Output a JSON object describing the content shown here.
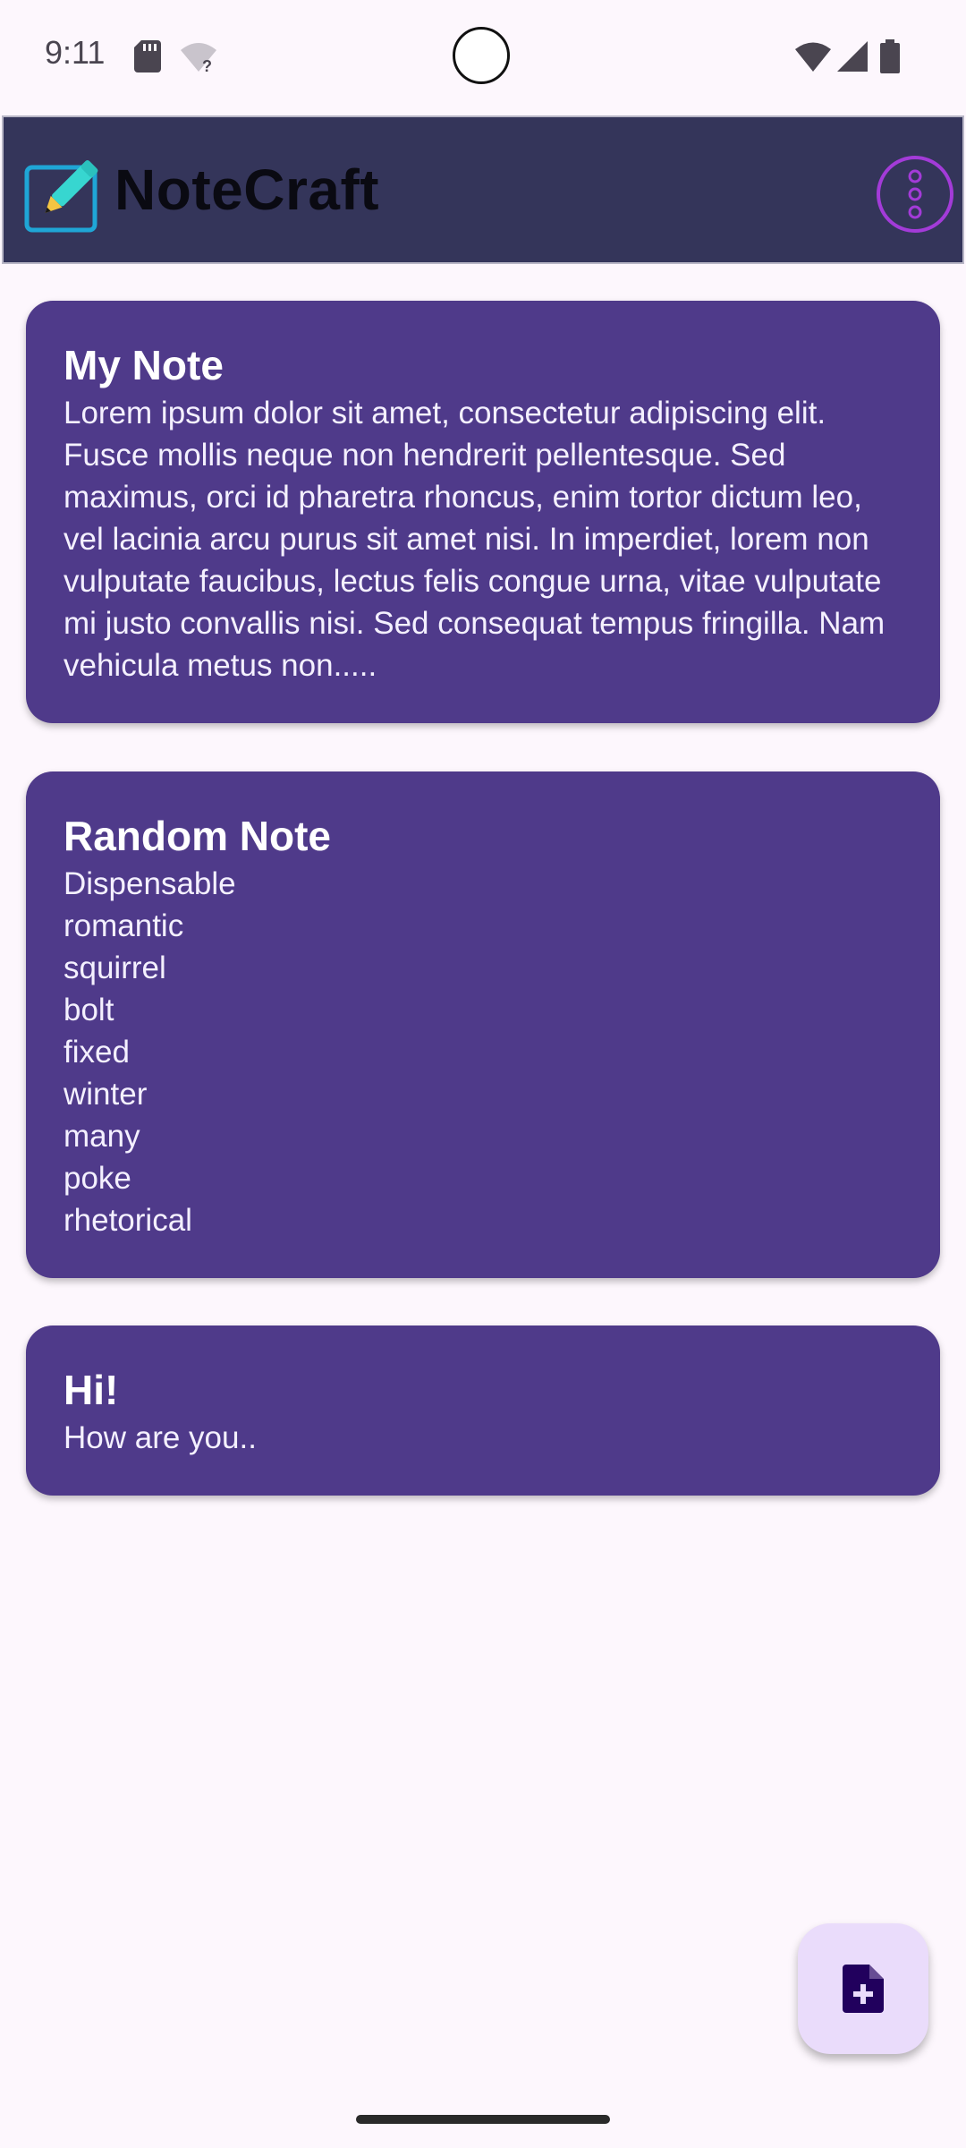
{
  "status_bar": {
    "time": "9:11",
    "icons": [
      "sd-card-icon",
      "wifi-question-icon",
      "wifi-icon",
      "signal-icon",
      "battery-icon"
    ]
  },
  "app_bar": {
    "title": "NoteCraft",
    "logo_icon": "edit-note-icon",
    "menu_icon": "more-vert-icon",
    "background": "#34355a"
  },
  "notes": [
    {
      "title": "My Note",
      "body": "Lorem ipsum dolor sit amet, consectetur adipiscing elit. Fusce mollis neque non hendrerit pellentesque. Sed maximus, orci id pharetra rhoncus, enim tortor dictum leo, vel lacinia arcu purus sit amet nisi. In imperdiet, lorem non vulputate faucibus, lectus felis congue urna, vitae vulputate mi justo convallis nisi. Sed consequat tempus fringilla. Nam vehicula metus non....."
    },
    {
      "title": "Random Note",
      "body": "Dispensable\nromantic\nsquirrel\nbolt\nfixed\nwinter\nmany\npoke\nrhetorical"
    },
    {
      "title": "Hi!",
      "body": "How are you.."
    }
  ],
  "fab": {
    "icon": "note-add-icon"
  },
  "colors": {
    "card": "#4f3a8a",
    "background": "#fdf7fd",
    "fab": "#eadcfb",
    "accent": "#a33bd8"
  }
}
